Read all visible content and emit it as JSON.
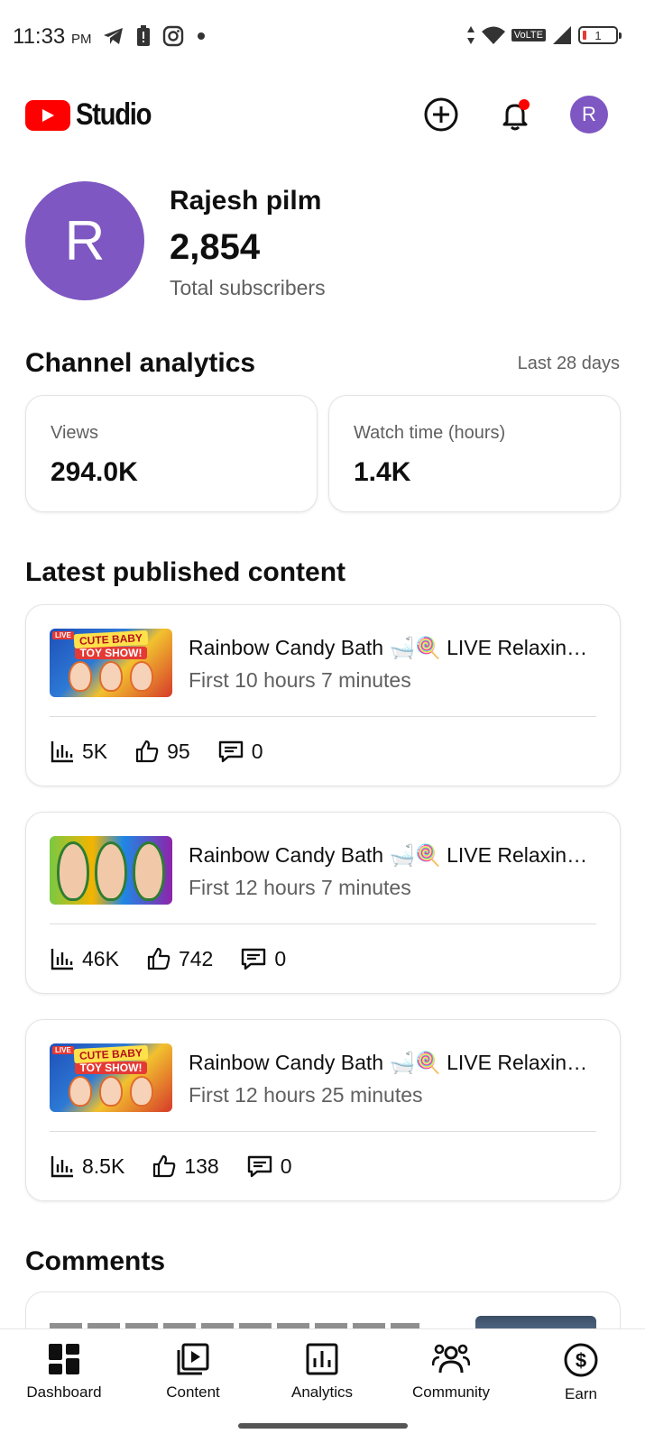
{
  "status_bar": {
    "time": "11:33",
    "ampm": "PM",
    "network_label": "VoLTE",
    "battery_level": "1",
    "icons": [
      "telegram-icon",
      "battery-saver-icon",
      "instagram-icon",
      "dot-icon",
      "data-arrows-icon",
      "wifi-icon",
      "signal-icon",
      "battery-icon"
    ]
  },
  "header": {
    "logo_text": "Studio",
    "avatar_initial": "R",
    "notification_dot_color": "#ff0000"
  },
  "channel": {
    "avatar_initial": "R",
    "avatar_color": "#7e57c2",
    "name": "Rajesh pilm",
    "subscribers": "2,854",
    "subscribers_label": "Total subscribers"
  },
  "analytics": {
    "title": "Channel analytics",
    "period": "Last 28 days",
    "cards": [
      {
        "label": "Views",
        "value": "294.0K"
      },
      {
        "label": "Watch time (hours)",
        "value": "1.4K"
      }
    ]
  },
  "latest": {
    "title": "Latest published content",
    "items": [
      {
        "title": "Rainbow Candy Bath 🛁🍭 LIVE Relaxing Baby Doll Bath Time",
        "subtitle": "First 10 hours 7 minutes",
        "views": "5K",
        "likes": "95",
        "comments": "0",
        "thumb_banner": "CUTE BABY",
        "thumb_banner2": "TOY SHOW!",
        "thumb_live": "LIVE"
      },
      {
        "title": "Rainbow Candy Bath 🛁🍭 LIVE Relaxing Baby Doll Bath Time",
        "subtitle": "First 12 hours 7 minutes",
        "views": "46K",
        "likes": "742",
        "comments": "0"
      },
      {
        "title": "Rainbow Candy Bath 🛁🍭 LIVE Relaxing Baby Doll Bath Time",
        "subtitle": "First 12 hours 25 minutes",
        "views": "8.5K",
        "likes": "138",
        "comments": "0",
        "thumb_banner": "CUTE BABY",
        "thumb_banner2": "TOY SHOW!",
        "thumb_live": "LIVE"
      }
    ]
  },
  "comments": {
    "title": "Comments"
  },
  "bottom_nav": {
    "items": [
      {
        "label": "Dashboard",
        "icon": "dashboard-icon"
      },
      {
        "label": "Content",
        "icon": "content-icon"
      },
      {
        "label": "Analytics",
        "icon": "analytics-icon"
      },
      {
        "label": "Community",
        "icon": "community-icon"
      },
      {
        "label": "Earn",
        "icon": "earn-icon"
      }
    ]
  }
}
